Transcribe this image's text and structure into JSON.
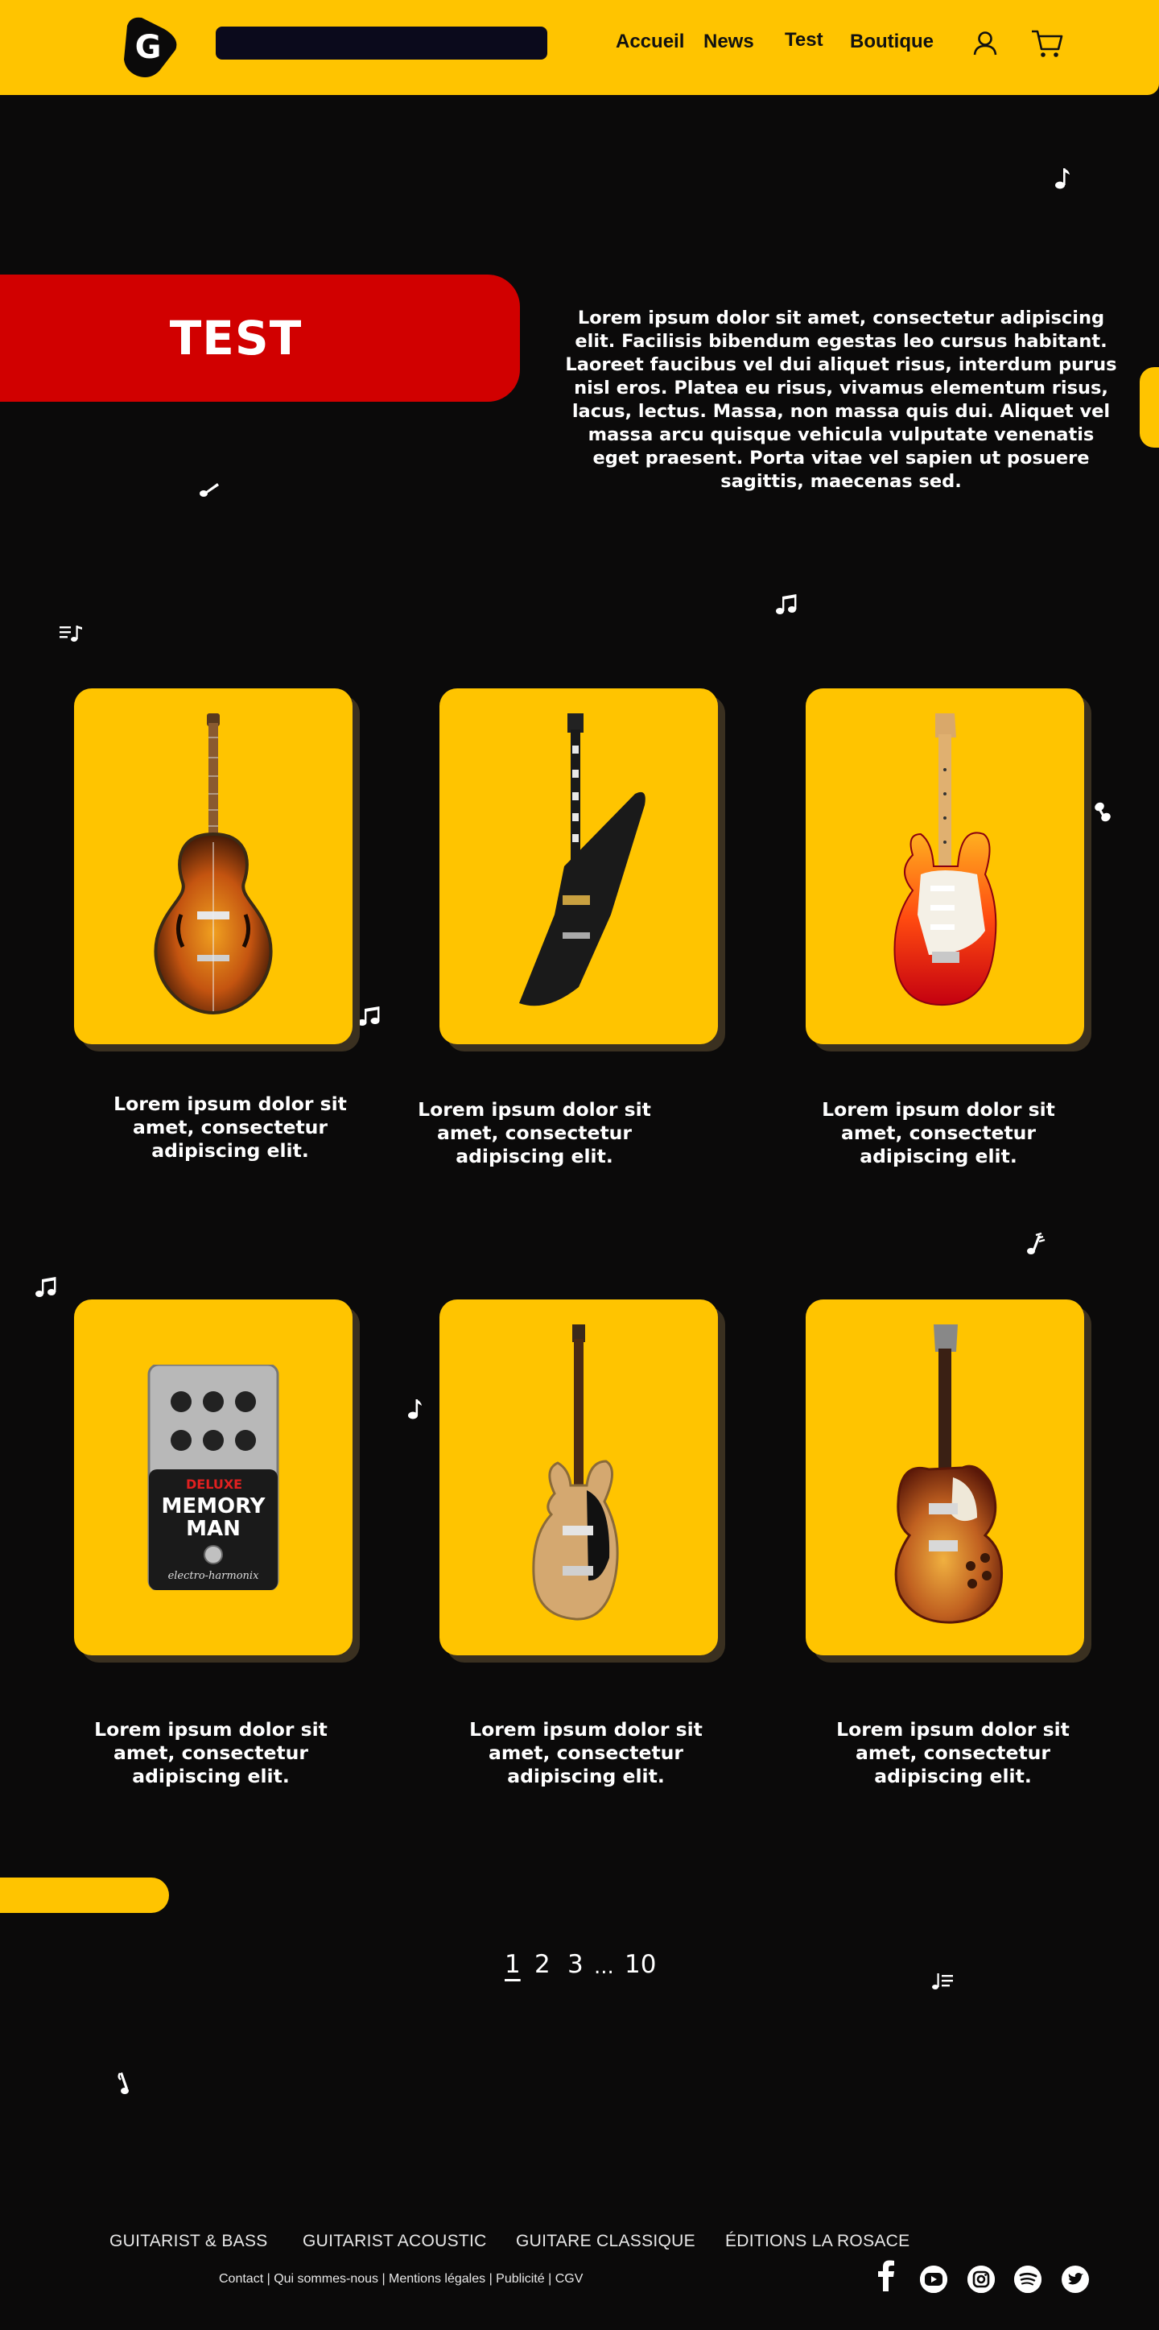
{
  "header": {
    "logo_letter": "G",
    "search_placeholder": "",
    "nav": [
      "Accueil",
      "News",
      "Test",
      "Boutique"
    ],
    "account_icon": "user-icon",
    "cart_icon": "cart-icon"
  },
  "hero": {
    "title": "TEST",
    "text": "Lorem ipsum dolor sit amet, consectetur adipiscing elit. Facilisis bibendum egestas leo cursus habitant. Laoreet faucibus vel dui aliquet risus, interdum purus nisl eros. Platea eu risus, vivamus elementum risus, lacus, lectus. Massa, non massa quis dui. Aliquet vel massa arcu quisque vehicula vulputate venenatis eget praesent. Porta vitae vel sapien ut posuere sagittis, maecenas sed."
  },
  "products": [
    {
      "image": "semi-hollow-archtop-guitar-sunburst",
      "caption": "Lorem ipsum dolor sit amet, consectetur adipiscing elit."
    },
    {
      "image": "explorer-style-guitar-black",
      "caption": "Lorem ipsum dolor sit amet, consectetur adipiscing elit."
    },
    {
      "image": "stratocaster-guitar-red",
      "caption": "Lorem ipsum dolor sit amet, consectetur adipiscing elit."
    },
    {
      "image": "memory-man-effects-pedal",
      "caption": "Lorem ipsum dolor sit amet, consectetur adipiscing elit."
    },
    {
      "image": "bass-guitar-gold",
      "caption": "Lorem ipsum dolor sit amet, consectetur adipiscing elit."
    },
    {
      "image": "les-paul-guitar-sunburst",
      "caption": "Lorem ipsum dolor sit amet, consectetur adipiscing elit."
    }
  ],
  "pedal": {
    "brand_line": "DELUXE",
    "name_line1": "MEMORY",
    "name_line2": "MAN",
    "maker": "electro-harmonix"
  },
  "pagination": {
    "pages": [
      "1",
      "2",
      "3",
      "...",
      "10"
    ],
    "current": "1"
  },
  "footer": {
    "nav": [
      "GUITARIST & BASS",
      "GUITARIST ACOUSTIC",
      "GUITARE CLASSIQUE",
      "ÉDITIONS LA ROSACE"
    ],
    "links": "Contact | Qui sommes-nous | Mentions légales | Publicité | CGV",
    "social": [
      "facebook-icon",
      "youtube-icon",
      "instagram-icon",
      "spotify-icon",
      "twitter-icon"
    ]
  },
  "colors": {
    "accent": "#ffc400",
    "hero_red": "#d10000",
    "background": "#0b0a0a"
  }
}
